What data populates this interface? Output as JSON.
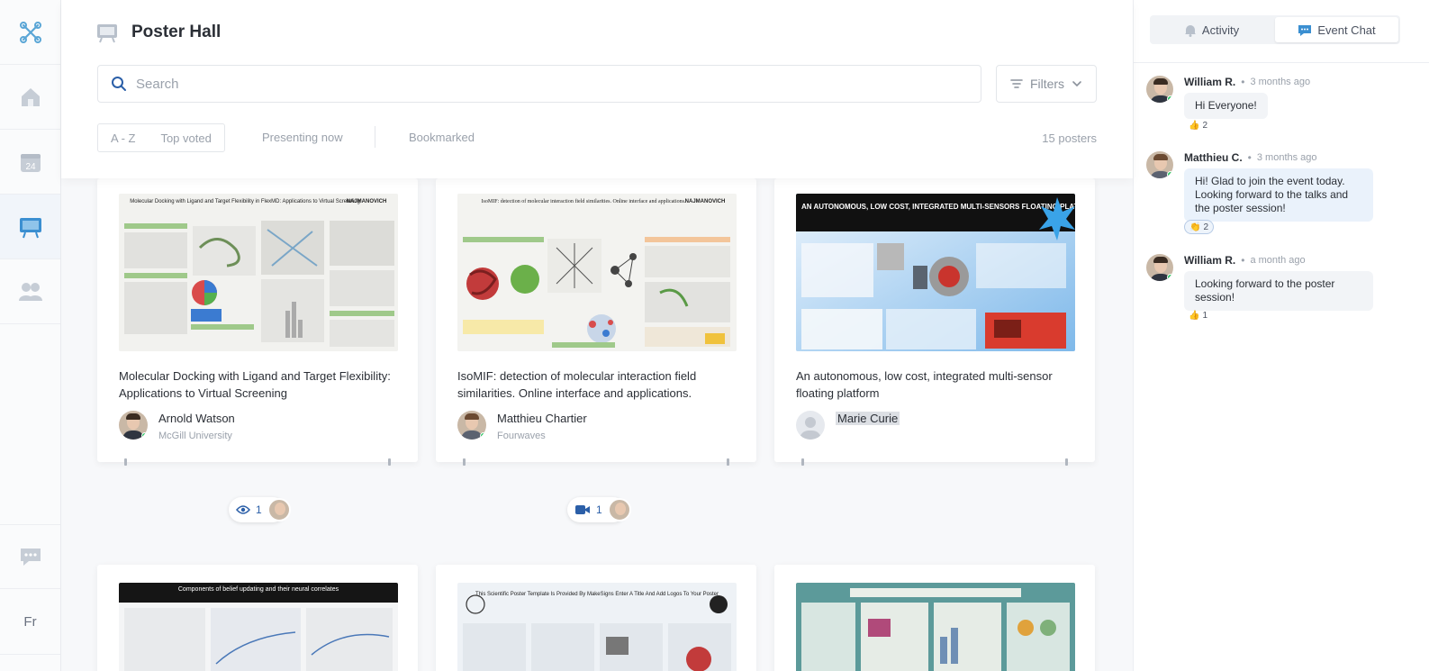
{
  "rail": {
    "logo_icon": "app-logo-icon",
    "items": [
      {
        "name": "home",
        "icon": "home-icon"
      },
      {
        "name": "calendar",
        "icon": "calendar-icon",
        "badge": "24"
      },
      {
        "name": "poster-hall",
        "icon": "poster-board-icon",
        "active": true
      },
      {
        "name": "people",
        "icon": "people-icon"
      },
      {
        "name": "chat",
        "icon": "chat-icon"
      }
    ],
    "language": "Fr"
  },
  "header": {
    "title": "Poster Hall",
    "search_placeholder": "Search",
    "filters_label": "Filters",
    "sort_options": [
      "A - Z",
      "Top voted"
    ],
    "tabs": [
      "Presenting now",
      "Bookmarked"
    ],
    "count": "15 posters"
  },
  "posters": [
    {
      "title": "Molecular Docking with Ligand and Target Flexibility: Applications to Virtual Screening",
      "author": "Arnold Watson",
      "org": "McGill University",
      "online": true,
      "viewers": "1",
      "viewer_icon": "eye-icon"
    },
    {
      "title": "IsoMIF: detection of molecular interaction field similarities. Online interface and applications.",
      "author": "Matthieu Chartier",
      "org": "Fourwaves",
      "online": true,
      "viewers": "1",
      "viewer_icon": "video-icon"
    },
    {
      "title": "An autonomous, low cost, integrated multi-sensor floating platform",
      "author": "Marie Curie",
      "org": "",
      "online": false
    }
  ],
  "poster_images": [
    {
      "header": "Molecular Docking with Ligand and Target Flexibility in FlexMD: Applications to Virtual Screening",
      "logo": "NAJMANOVICH"
    },
    {
      "header": "IsoMIF: detection of molecular interaction field similarities. Online interface and applications.",
      "logo": "NAJMANOVICH"
    },
    {
      "header": "AN AUTONOMOUS, LOW COST, INTEGRATED MULTI-SENSORS FLOATING PLATFORM"
    },
    {
      "header": "Components of belief updating and their neural correlates"
    },
    {
      "header": "This Scientific Poster Template Is Provided By MakeSigns Enter A Title And Add Logos To Your Poster"
    },
    {
      "header": ""
    }
  ],
  "panel": {
    "tabs": [
      {
        "label": "Activity",
        "icon": "bell-icon"
      },
      {
        "label": "Event Chat",
        "icon": "chat-icon",
        "active": true
      }
    ],
    "messages": [
      {
        "name": "William R.",
        "time": "3 months ago",
        "text": "Hi Everyone!",
        "reaction_emoji": "👍",
        "reaction_count": "2"
      },
      {
        "name": "Matthieu C.",
        "time": "3 months ago",
        "text": "Hi! Glad to join the event today. Looking forward to the talks and the poster session!",
        "reaction_emoji": "👏",
        "reaction_count": "2"
      },
      {
        "name": "William R.",
        "time": "a month ago",
        "text": "Looking forward to the poster session!",
        "reaction_emoji": "👍",
        "reaction_count": "1"
      }
    ]
  },
  "colors": {
    "accent": "#2b5fa8",
    "online": "#22c55e",
    "chat_bubble_highlight": "#eaf2fb"
  }
}
